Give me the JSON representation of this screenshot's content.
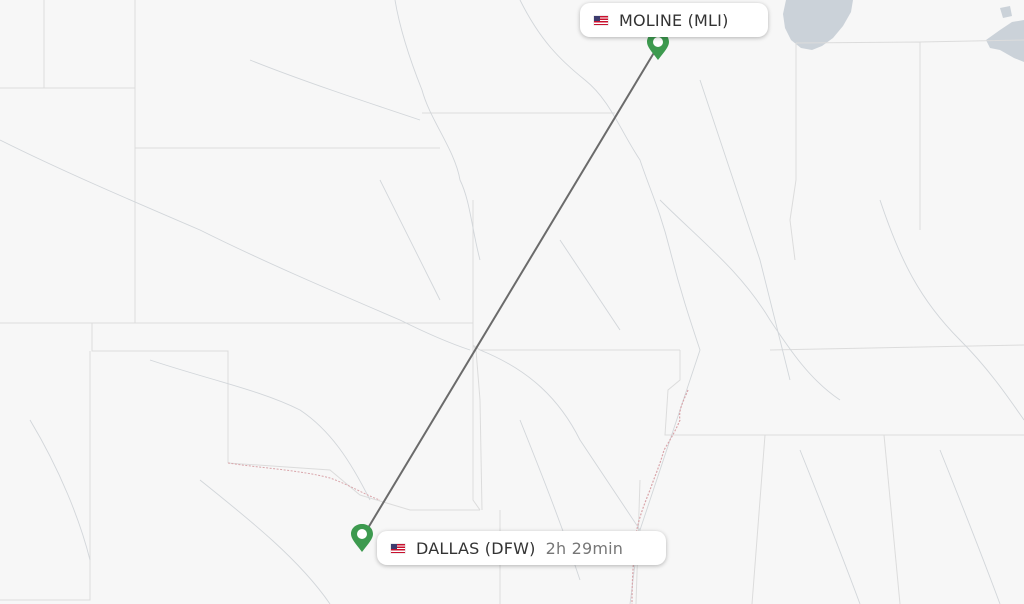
{
  "origin": {
    "city_label": "MOLINE (MLI)",
    "flag_icon": "us-flag-icon",
    "marker_color": "#3d9a4f"
  },
  "destination": {
    "city_label": "DALLAS (DFW)",
    "duration": "2h 29min",
    "flag_icon": "us-flag-icon",
    "marker_color": "#3d9a4f"
  },
  "route": {
    "line_color": "#6b6b6b"
  },
  "map": {
    "land_color": "#f7f7f7",
    "water_color": "#c9d3dc",
    "border_color": "#d9d9d9"
  }
}
